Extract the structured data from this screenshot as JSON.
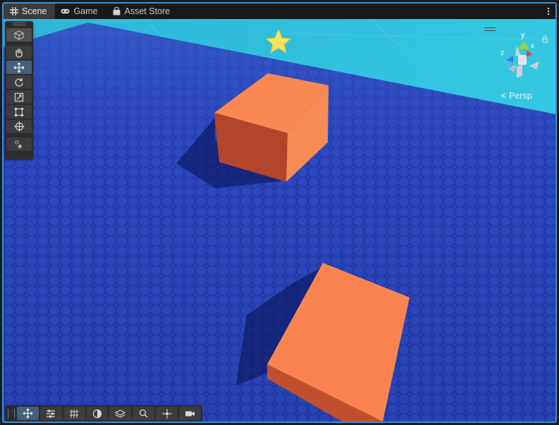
{
  "tabs": [
    {
      "label": "Scene",
      "icon": "grid-icon",
      "active": true
    },
    {
      "label": "Game",
      "icon": "gamepad-icon",
      "active": false
    },
    {
      "label": "Asset Store",
      "icon": "shopping-bag-icon",
      "active": false
    }
  ],
  "tab_menu": {
    "icon": "kebab-menu-icon"
  },
  "tools": [
    {
      "name": "view-tool",
      "icon": "hand-icon"
    },
    {
      "name": "move-tool",
      "icon": "move-arrows-icon",
      "selected": true
    },
    {
      "name": "rotate-tool",
      "icon": "rotate-icon"
    },
    {
      "name": "scale-tool",
      "icon": "scale-icon"
    },
    {
      "name": "rect-tool",
      "icon": "rect-icon"
    },
    {
      "name": "transform-tool",
      "icon": "transform-icon"
    },
    {
      "name": "custom-tool",
      "icon": "custom-tool-icon"
    }
  ],
  "orientation": {
    "axes": [
      "y",
      "x",
      "z"
    ],
    "projection_label": "Persp",
    "colors": {
      "x": "#e2463a",
      "y": "#8fd44a",
      "z": "#3f7ee8"
    }
  },
  "bottom_tools": [
    "move-icon",
    "settings-sliders-icon",
    "grid-snap-icon",
    "shading-icon",
    "layers-icon",
    "search-icon",
    "gizmos-icon",
    "camera-icon"
  ],
  "colors": {
    "accent": "#3a8fd6",
    "floor": "#2a45b8",
    "sky": "#2fc0dc",
    "cube": "#f88452",
    "light": "#f8e35a"
  }
}
